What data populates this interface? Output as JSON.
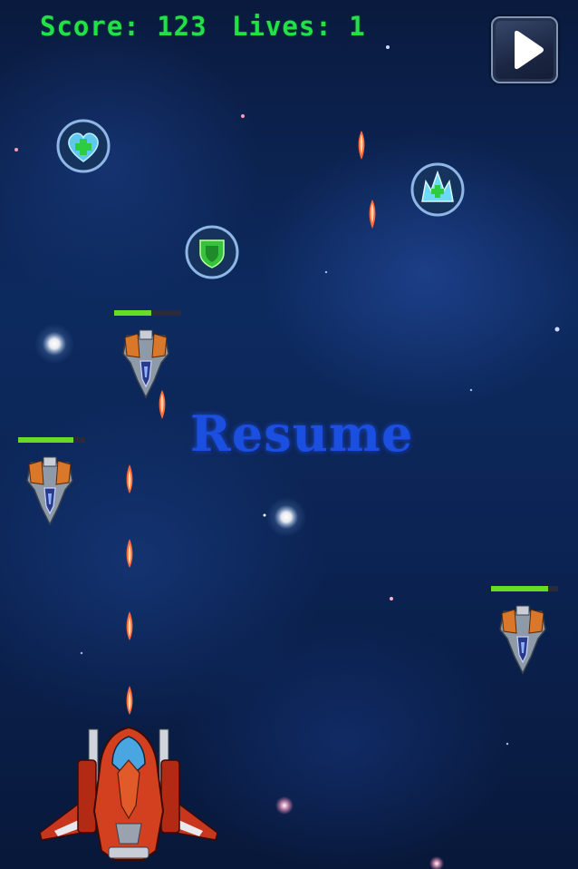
{
  "hud": {
    "score_label": "Score: 123",
    "lives_label": "Lives: 1",
    "score": 123,
    "lives": 1,
    "text_color": "#22e04a"
  },
  "controls": {
    "play_icon": "play-icon"
  },
  "overlay": {
    "resume_label": "Resume",
    "resume_color": "#1a4fe0"
  },
  "powerups": [
    {
      "name": "heart-health",
      "icon": "heart-icon"
    },
    {
      "name": "shield",
      "icon": "shield-icon"
    },
    {
      "name": "crystal",
      "icon": "crystal-icon"
    }
  ],
  "enemies": [
    {
      "health_fraction": 0.55
    },
    {
      "health_fraction": 0.82
    },
    {
      "health_fraction": 0.85
    }
  ],
  "colors": {
    "background": "#0d2a5f",
    "health_bar": "#66dd22",
    "player_ship": "#c8361e",
    "bullet": "#ff6a3a"
  }
}
